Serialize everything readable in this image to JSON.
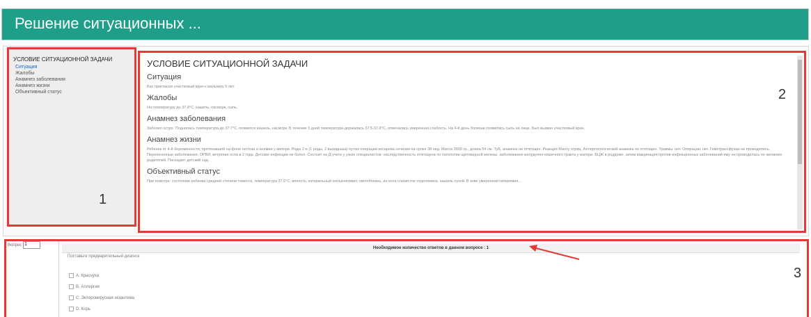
{
  "header": {
    "title": "Решение ситуационных ..."
  },
  "sidebar": {
    "title": "УСЛОВИЕ СИТУАЦИОННОЙ ЗАДАЧИ",
    "items": [
      {
        "label": "Ситуация",
        "active": true
      },
      {
        "label": "Жалобы"
      },
      {
        "label": "Анамнез заболевания"
      },
      {
        "label": "Анамнез жизни"
      },
      {
        "label": "Объективный статус"
      }
    ],
    "marker": "1"
  },
  "content": {
    "heading": "УСЛОВИЕ СИТУАЦИОННОЙ ЗАДАЧИ",
    "marker": "2",
    "sections": [
      {
        "title": "Ситуация",
        "text": "Вас пригласил участковый врач к мальчику 5 лет."
      },
      {
        "title": "Жалобы",
        "text": "На температуру до 37.8°С, кашель, насморк, сыпь."
      },
      {
        "title": "Анамнез заболевания",
        "text": "Заболел остро. Поднялась температура до 37.7°С, появился кашель, насморк. В течение 3 дней температура держалась 37.5-37.8°С, отмечалась умеренная слабость. На 4-й день болезни появилась сыпь на лице. Был вызван участковый врач."
      },
      {
        "title": "Анамнез жизни",
        "text": "Ребенок от 4-й беременности, протекавшей на фоне гестоза и анемии у матери. Роды 2-е (1 роды, 2 выкидыша) путем операции кесарева сечения на сроке 38 нед. Масса 3500 гр., длина 54 см. ТуБ, анамнез не отягощен. Реакция Манту отриц. Аллергологический анамнез не отягощен. Травмы: нет. Операции: нет. Гемотрансфузии не проводились. Перенесенные заболевания: ОРВИ, ветряная оспа в 2 года. Детские инфекции не болел. Состоит на Д-учете у узких специалистов: наследственность отягощена по патологии щитовидной железы, заболеванию желудочно-кишечного тракта у матери. БЦЖ в роддоме, затем вакцинация против инфекционных заболеваний ему не проводилась по желанию родителей. Посещает детский сад."
      },
      {
        "title": "Объективный статус",
        "text": "При осмотре: состояние ребенка средней степени тяжести, температура 37.5°С, вялость, катаральный конъюнктивит, светобоязнь, из носа слизистое отделяемое, кашель сухой. В зеве умеренная гиперемия..."
      }
    ]
  },
  "question": {
    "number_label": "Вопрос",
    "number_value": "1",
    "header": "Необходимое количество ответов в данном вопросе : 1",
    "text": "Поставьте предварительный диагноз",
    "options": [
      "A. Краснуха",
      "B. Аллергия",
      "C. Энтеровирусная экзантема",
      "D. Корь"
    ],
    "marker": "3"
  },
  "colors": {
    "header_bg": "#1f9e8a",
    "highlight": "#e53935"
  }
}
